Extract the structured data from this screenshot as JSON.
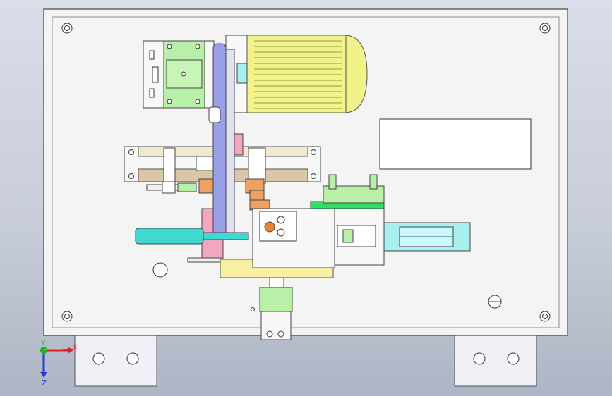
{
  "viewport": {
    "background_top": "#d9dee8",
    "background_bottom": "#aeb5c4"
  },
  "triad": {
    "x_label": "X",
    "y_label": "Y",
    "z_label": "Z",
    "x_color": "#e02020",
    "y_color": "#20b020",
    "z_color": "#2040d0"
  },
  "colors": {
    "plate": "#f4f4f4",
    "motor_yellow": "#f2f28a",
    "green_part": "#b8f0a8",
    "blue_belt": "#9aa0e8",
    "cyan_cylinder": "#40d8d0",
    "light_cyan": "#a8f0f0",
    "tan_rail": "#d8c8a8",
    "pink_part": "#f0a8c0",
    "orange_part": "#f0a060",
    "bright_green": "#30e060"
  },
  "icons": {
    "triad": "coordinate-triad-icon"
  }
}
